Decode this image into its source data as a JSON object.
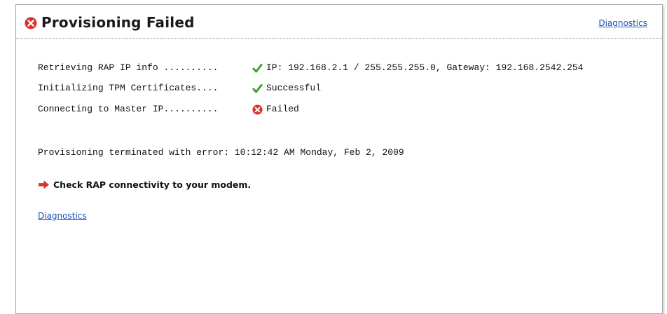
{
  "header": {
    "title": "Provisioning Failed",
    "title_icon": "error-circle-icon",
    "diagnostics_link": "Diagnostics"
  },
  "steps": [
    {
      "label": "Retrieving RAP IP info ..........",
      "status_icon": "checkmark-icon",
      "result": "IP: 192.168.2.1 / 255.255.255.0, Gateway: 192.168.2542.254"
    },
    {
      "label": "Initializing TPM Certificates....",
      "status_icon": "checkmark-icon",
      "result": "Successful"
    },
    {
      "label": "Connecting to Master IP..........",
      "status_icon": "error-circle-icon",
      "result": "Failed"
    }
  ],
  "error_message": "Provisioning terminated with error: 10:12:42 AM Monday, Feb 2, 2009",
  "advice": {
    "icon": "red-arrow-right-icon",
    "text": "Check RAP connectivity to your modem."
  },
  "footer": {
    "diagnostics_link": "Diagnostics"
  },
  "colors": {
    "error_red": "#d9322b",
    "success_green": "#3a9a2a",
    "link_blue": "#1a52b5",
    "border_gray": "#a9a9a9"
  }
}
